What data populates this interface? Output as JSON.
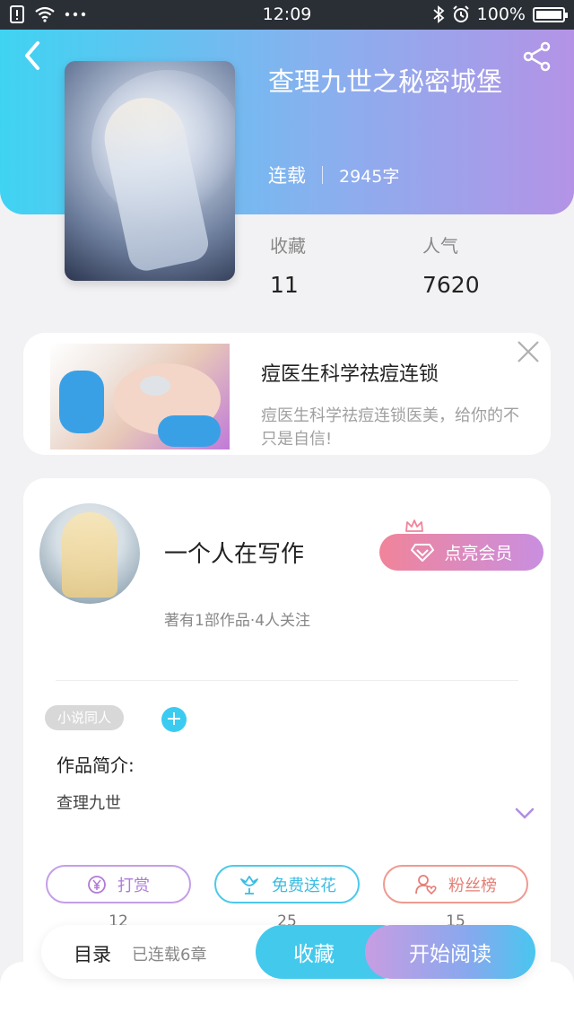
{
  "status_bar": {
    "time": "12:09",
    "battery": "100%"
  },
  "book": {
    "title": "查理九世之秘密城堡",
    "status": "连载",
    "word_count": "2945字",
    "stats": [
      {
        "label": "收藏",
        "value": "11"
      },
      {
        "label": "人气",
        "value": "7620"
      }
    ]
  },
  "ad": {
    "title": "痘医生科学祛痘连锁",
    "description_line1": "痘医生科学祛痘连锁医美，给你的不",
    "description_line2": "只是自信!"
  },
  "author": {
    "name": "一个人在写作",
    "sub": "著有1部作品·4人关注",
    "vip_button": "点亮会员"
  },
  "tags": [
    "小说同人"
  ],
  "tag_add": "+",
  "intro": {
    "title": "作品简介:",
    "text": "查理九世"
  },
  "actions": [
    {
      "label": "打赏",
      "count": "12"
    },
    {
      "label": "免费送花",
      "count": "25"
    },
    {
      "label": "粉丝榜",
      "count": "15"
    }
  ],
  "bottom_bar": {
    "toc": "目录",
    "toc_sub": "已连载6章",
    "collect": "收藏",
    "read": "开始阅读"
  },
  "colors": {
    "accent_cyan": "#43c9ec",
    "accent_purple": "#b493e6",
    "vip_pink": "#f0849a"
  }
}
